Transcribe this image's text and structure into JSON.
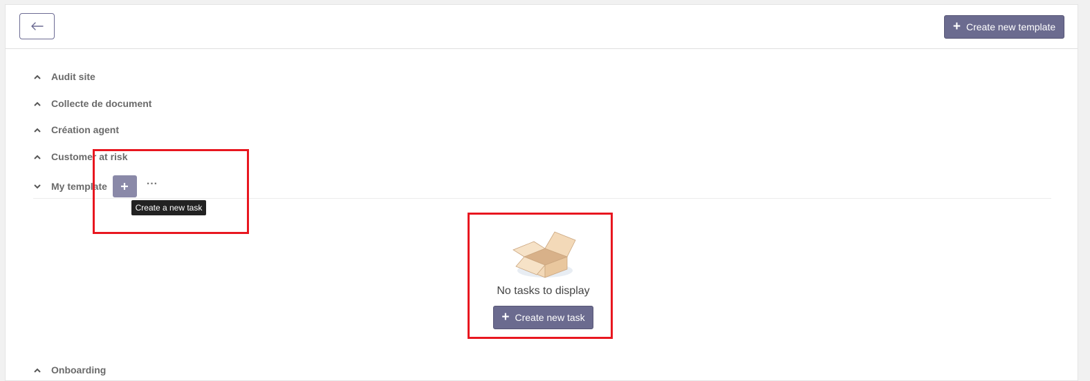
{
  "header": {
    "create_template_label": "Create new template"
  },
  "groups": [
    {
      "label": "Audit site",
      "expanded": false
    },
    {
      "label": "Collecte de document",
      "expanded": false
    },
    {
      "label": "Création agent",
      "expanded": false
    },
    {
      "label": "Customer at risk",
      "expanded": false
    },
    {
      "label": "My template",
      "expanded": true
    },
    {
      "label": "Onboarding",
      "expanded": false
    }
  ],
  "tooltip": {
    "text": "Create a new task"
  },
  "empty_state": {
    "message": "No tasks to display",
    "create_task_label": "Create new task"
  },
  "colors": {
    "primary": "#6b6b8f",
    "highlight": "#e8161f"
  }
}
